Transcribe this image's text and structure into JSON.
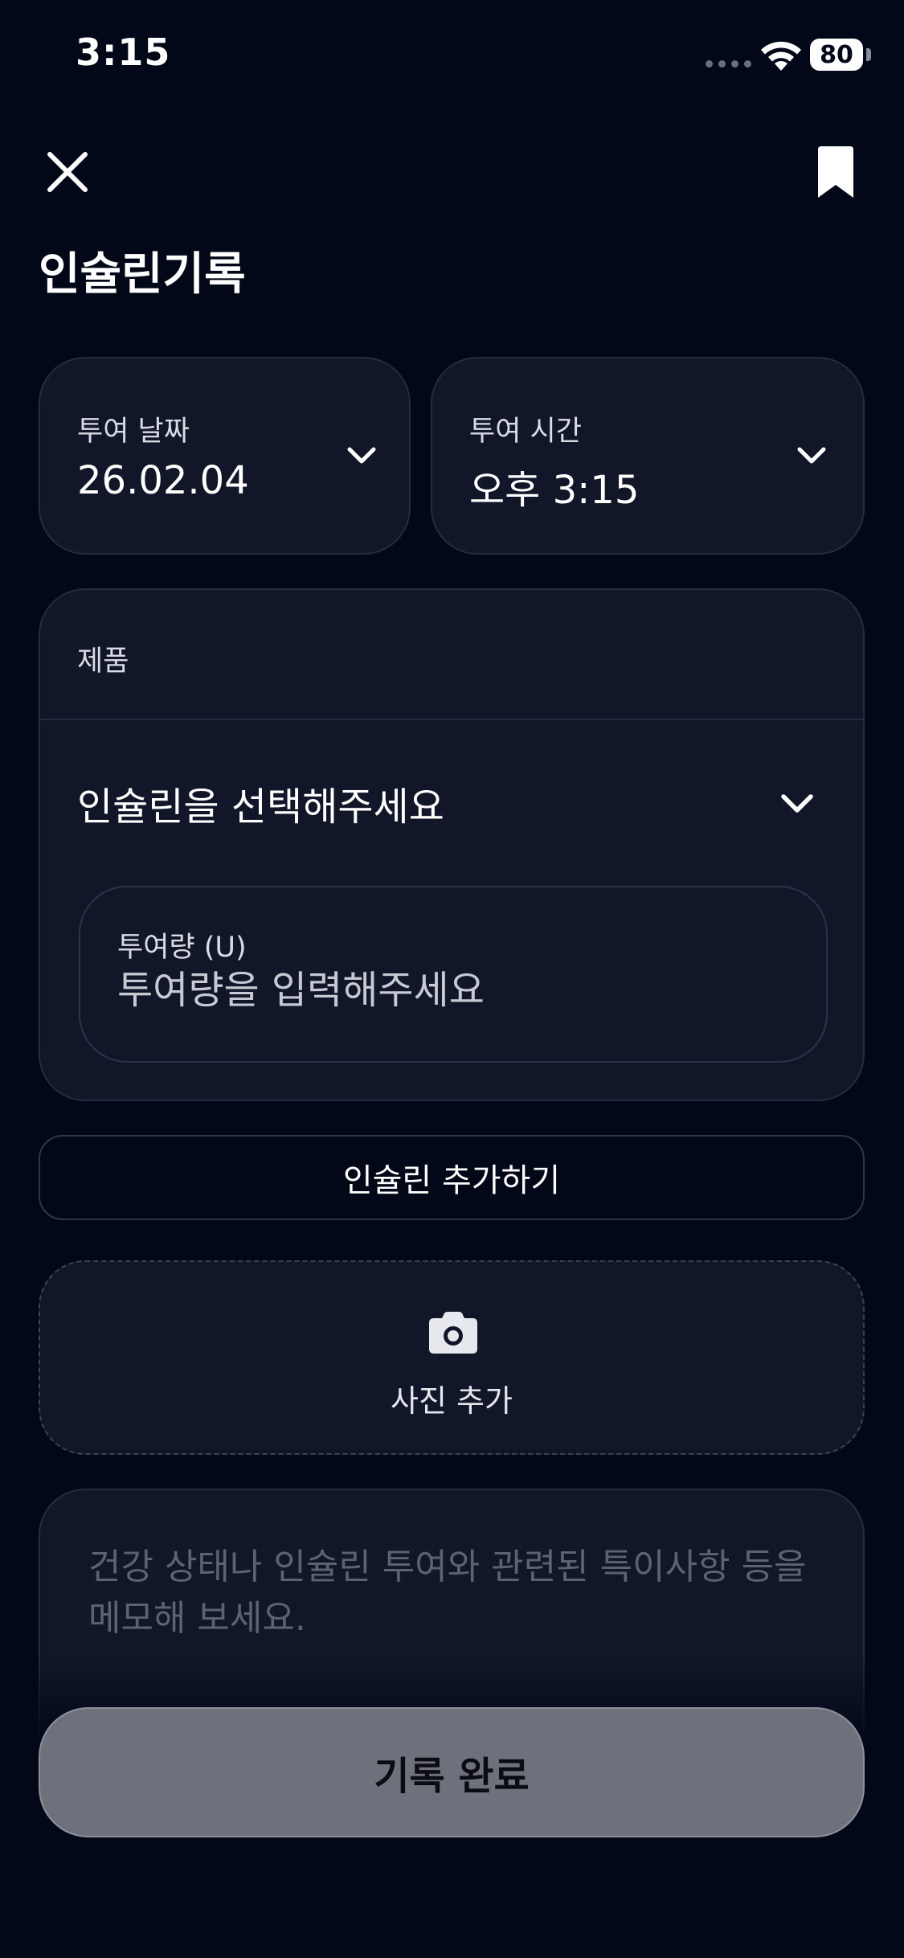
{
  "status_bar": {
    "time": "3:15",
    "battery": "80"
  },
  "header": {
    "close_icon": "close-icon",
    "bookmark_icon": "bookmark-icon",
    "title": "인슐린기록"
  },
  "date_field": {
    "label": "투여 날짜",
    "value": "26.02.04"
  },
  "time_field": {
    "label": "투여 시간",
    "value": "오후 3:15"
  },
  "product": {
    "label": "제품",
    "select_placeholder": "인슐린을 선택해주세요",
    "dose_label": "투여량 (U)",
    "dose_placeholder": "투여량을 입력해주세요",
    "dose_value": ""
  },
  "add_insulin_label": "인슐린 추가하기",
  "photo": {
    "icon": "camera-icon",
    "label": "사진 추가"
  },
  "memo": {
    "placeholder": "건강 상태나 인슐린 투여와 관련된 특이사항 등을 메모해 보세요.",
    "value": ""
  },
  "submit_label": "기록 완료",
  "colors": {
    "background": "#030818",
    "card": "#111729",
    "card_border": "#252c3f",
    "submit_disabled": "#6e717c"
  }
}
